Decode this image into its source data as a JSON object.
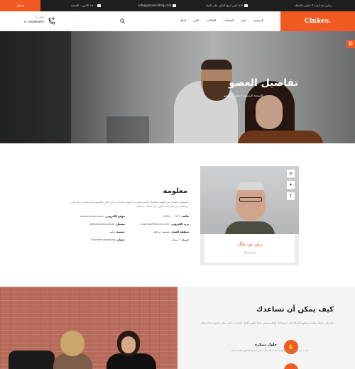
{
  "topbar": {
    "login_label": "تسجيل",
    "notice": "ربكين لمد لمدة لا انتكي، الانتقاء",
    "address": "٥٦٨ ليس لديها التأثير على البيئة",
    "email": "info@peramisiting.com",
    "hours": "١٥٠٠ الاثنين - الجمعة"
  },
  "header": {
    "phone_label": "اتصل بنا",
    "phone_number": "١٨٠٥٥٥٥٥٥٥٢٥",
    "nav": [
      "الرئيسية",
      "حول",
      "الصفحات",
      "المقالات",
      "الخبر",
      "اتصل"
    ],
    "brand": "Cinkes."
  },
  "hero": {
    "title": "تفاصيل العضو",
    "subtitle": "الصفحة الرئيسية / تفاصيل العضو"
  },
  "member": {
    "name": "ربي بي ملك",
    "role": "مصمم أول",
    "socials": [
      "instagram-icon",
      "twitter-icon",
      "facebook-icon"
    ],
    "info_title": "معلومة",
    "info_desc": "المعلومات العامة عن العضو وتفاصيل العمل والخبرات المهنية والإنجازات في مجال التصميم والاستشارات وقد عمل مع العديد من الشركات الكبرى في مجالات مختلفة.",
    "details": [
      {
        "label": "هاتف",
        "value": "٠١٢٣٤ ٥٦٧٨٩٠"
      },
      {
        "label": "موقع إلكتروني",
        "value": "webexample.com"
      },
      {
        "label": "بريد الكتروني",
        "value": "example@gmail.com"
      },
      {
        "label": "يشتغل",
        "value": "Webfountexample"
      },
      {
        "label": "منطقة العمل",
        "value": "تصميم جرافيك"
      },
      {
        "label": "جنسية",
        "value": "مصر"
      },
      {
        "label": "خبرة",
        "value": "٨ سنوات"
      },
      {
        "label": "عنوان",
        "value": "ThemePix Reading"
      }
    ]
  },
  "help": {
    "title": "كيف يمكن أن تساعدك",
    "desc": "نحن نقدم حلولاً مبتكرة ومتطورة لعملائنا في جميع أنحاء العالم ونسعى دائماً لتقديم أفضل الخدمات بأعلى معايير الجودة والاحترافية.",
    "service_title": "حلول مبتكرة",
    "service_desc": "نقدم خدمات استشارية متكاملة تساعد الشركات على تحقيق أهدافها بكفاءة عالية.",
    "icon": "hand-icon"
  },
  "colors": {
    "accent": "#f15a22",
    "dark": "#1f1f1f"
  }
}
